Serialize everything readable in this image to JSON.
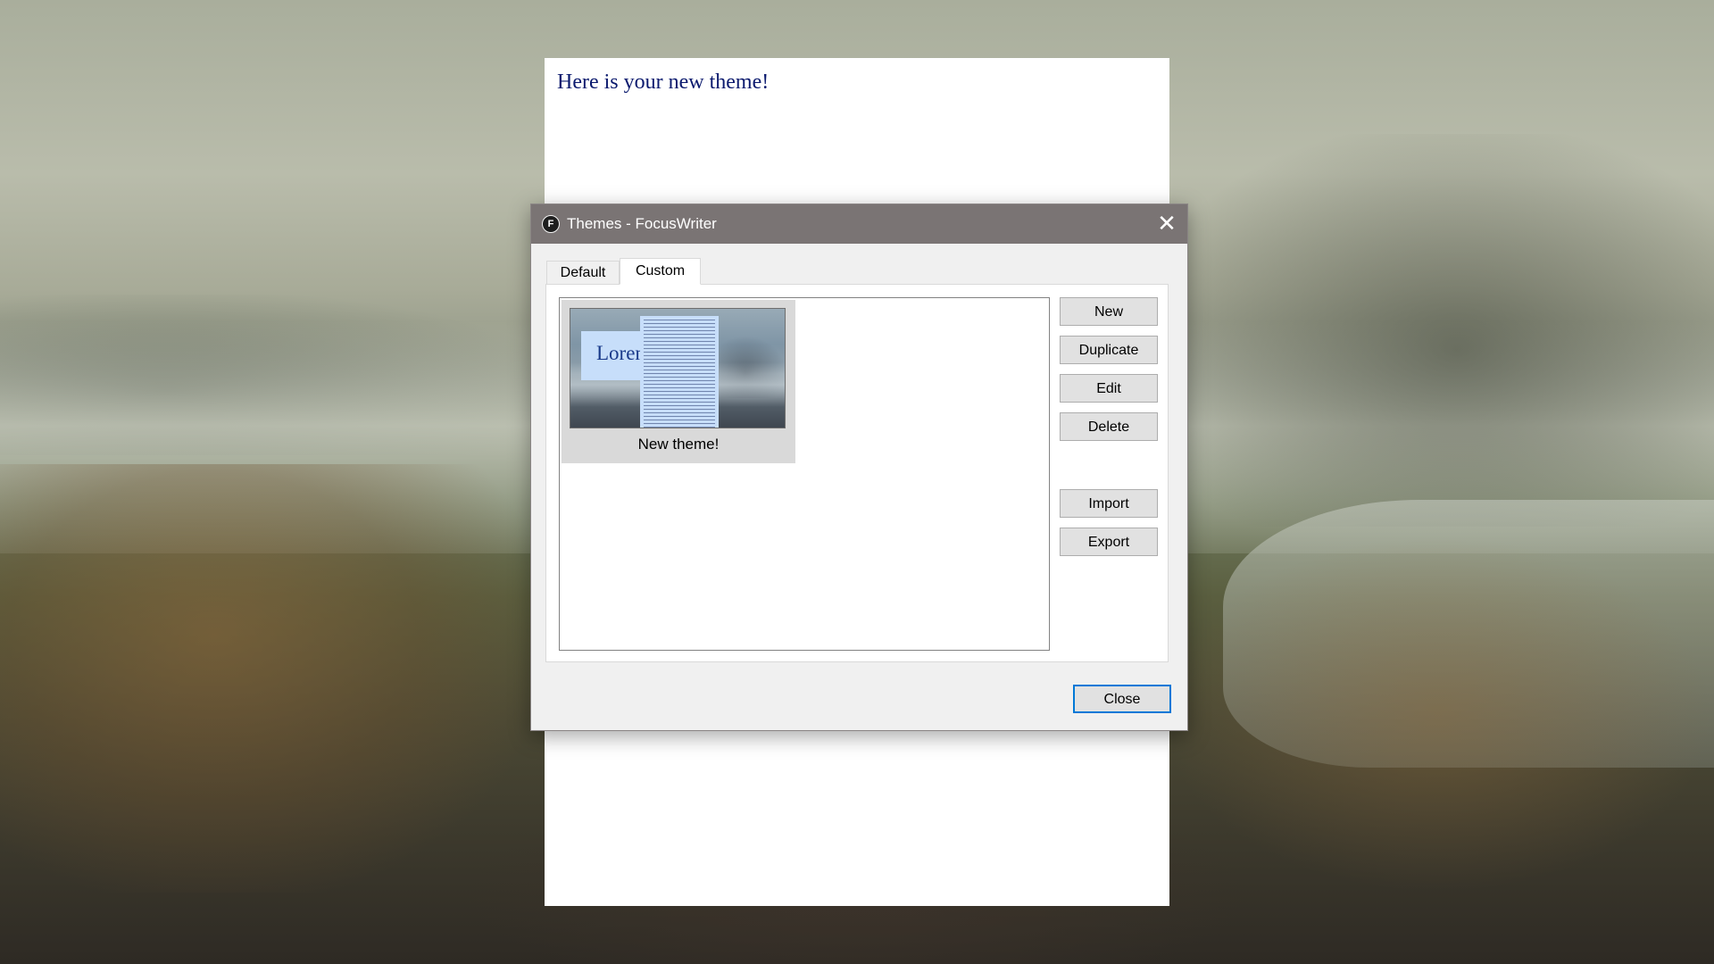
{
  "editor": {
    "text": "Here is your new theme!"
  },
  "dialog": {
    "app_icon_letter": "F",
    "title": "Themes - FocusWriter",
    "close_glyph": "✕",
    "tabs": [
      {
        "label": "Default",
        "active": false
      },
      {
        "label": "Custom",
        "active": true
      }
    ],
    "themes": [
      {
        "name": "New theme!",
        "preview_text": "Lorem ipsum"
      }
    ],
    "side_buttons": {
      "new": "New",
      "duplicate": "Duplicate",
      "edit": "Edit",
      "delete": "Delete",
      "import": "Import",
      "export": "Export"
    },
    "close_button": "Close"
  },
  "colors": {
    "titlebar": "#7a7474",
    "editor_text": "#0b1a6e",
    "focus_accent": "#0078d7"
  }
}
